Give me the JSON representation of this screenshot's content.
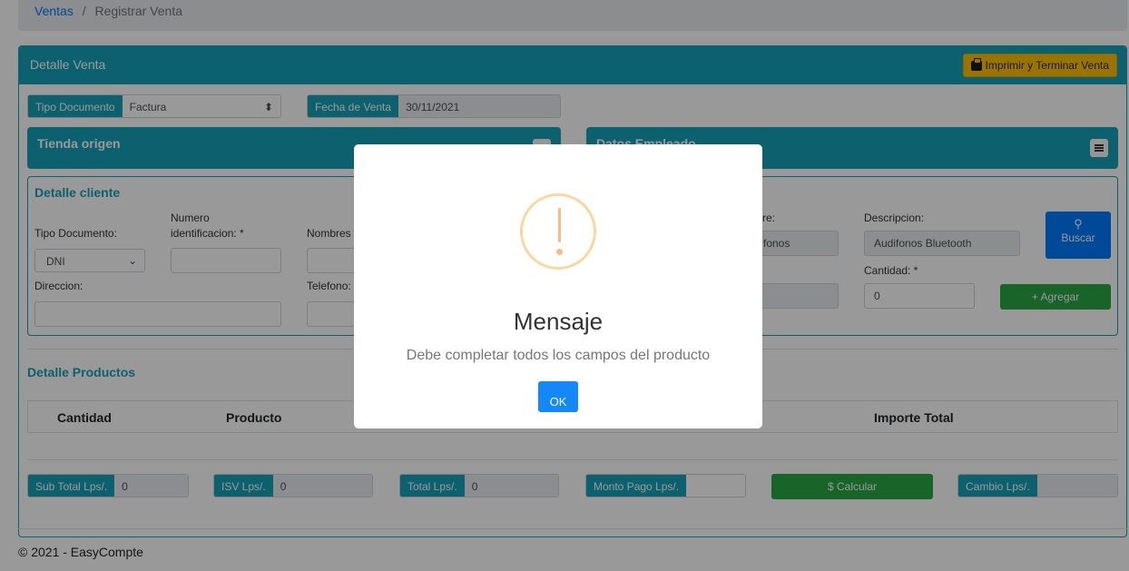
{
  "breadcrumb": {
    "root": "Ventas",
    "separator": "/",
    "current": "Registrar Venta"
  },
  "detalle_venta": {
    "title": "Detalle Venta",
    "print_button": "Imprimir y Terminar Venta",
    "tipo_documento_label": "Tipo Documento",
    "tipo_documento_value": "Factura",
    "fecha_label": "Fecha de Venta",
    "fecha_value": "30/11/2021"
  },
  "tienda": {
    "title": "Tienda origen"
  },
  "empleado": {
    "title": "Datos Empleado"
  },
  "cliente": {
    "title": "Detalle cliente",
    "tipo_doc_label": "Tipo Documento:",
    "tipo_doc_value": "DNI",
    "numero_label_1": "Numero",
    "numero_label_2": "identificacion: *",
    "nombres_label": "Nombres",
    "direccion_label": "Direccion:",
    "telefono_label": "Telefono:"
  },
  "producto": {
    "nombre_label": "re:",
    "nombre_value": "fonos",
    "descripcion_label": "Descripcion:",
    "descripcion_value": "Audifonos Bluetooth",
    "cantidad_label": "Cantidad: *",
    "cantidad_value": "0",
    "buscar_label": "Buscar",
    "agregar_label": "+ Agregar"
  },
  "productos_table": {
    "title": "Detalle Productos",
    "col_cantidad": "Cantidad",
    "col_producto": "Producto",
    "col_importe": "Importe Total"
  },
  "totales": {
    "subtotal_label": "Sub Total Lps/.",
    "subtotal_value": "0",
    "isv_label": "ISV Lps/.",
    "isv_value": "0",
    "total_label": "Total Lps/.",
    "total_value": "0",
    "monto_label": "Monto Pago Lps/.",
    "calcular_label": "$ Calcular",
    "cambio_label": "Cambio Lps/."
  },
  "footer": "© 2021 - EasyCompte",
  "modal": {
    "title": "Mensaje",
    "text": "Debe completar todos los campos del producto",
    "ok_label": "OK"
  },
  "colors": {
    "info": "#17a2b8",
    "primary": "#007bff",
    "success": "#28a745",
    "warning": "#ffc107"
  }
}
